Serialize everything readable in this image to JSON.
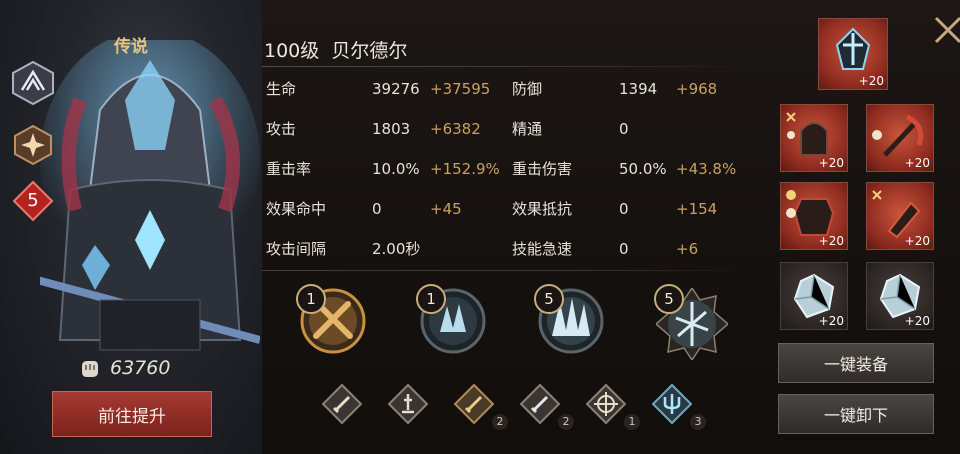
{
  "hero": {
    "rarity": "传说",
    "title": "100级  贝尔德尔",
    "level_badge": "5",
    "power": "63760",
    "goto_button": "前往提升"
  },
  "stats": [
    {
      "name": "生命",
      "base": "39276",
      "bonus": "+37595",
      "name2": "防御",
      "base2": "1394",
      "bonus2": "+968"
    },
    {
      "name": "攻击",
      "base": "1803",
      "bonus": "+6382",
      "name2": "精通",
      "base2": "0",
      "bonus2": ""
    },
    {
      "name": "重击率",
      "base": "10.0%",
      "bonus": "+152.9%",
      "name2": "重击伤害",
      "base2": "50.0%",
      "bonus2": "+43.8%"
    },
    {
      "name": "效果命中",
      "base": "0",
      "bonus": "+45",
      "name2": "效果抵抗",
      "base2": "0",
      "bonus2": "+154"
    },
    {
      "name": "攻击间隔",
      "base": "2.00秒",
      "bonus": "",
      "name2": "技能急速",
      "base2": "0",
      "bonus2": "+6"
    }
  ],
  "skills": [
    {
      "level": "1",
      "icon": "crossed-swords-icon"
    },
    {
      "level": "1",
      "icon": "ice-shard-icon"
    },
    {
      "level": "5",
      "icon": "ice-spikes-icon"
    },
    {
      "level": "5",
      "icon": "shatter-icon"
    }
  ],
  "runes": [
    {
      "icon": "sword-rune-icon",
      "count": ""
    },
    {
      "icon": "altar-rune-icon",
      "count": ""
    },
    {
      "icon": "dagger-rune-icon",
      "count": "2"
    },
    {
      "icon": "blade-rune-icon",
      "count": "2"
    },
    {
      "icon": "crosshair-rune-icon",
      "count": "1"
    },
    {
      "icon": "trident-rune-icon",
      "count": "3"
    }
  ],
  "equipment": [
    {
      "slot": "crest",
      "level": "+20"
    },
    {
      "slot": "helmet",
      "level": "+20"
    },
    {
      "slot": "weapon",
      "level": "+20"
    },
    {
      "slot": "armor",
      "level": "+20"
    },
    {
      "slot": "gloves",
      "level": "+20"
    },
    {
      "slot": "crystal-1",
      "level": "+20"
    },
    {
      "slot": "crystal-2",
      "level": "+20"
    }
  ],
  "buttons": {
    "equip_all": "一键装备",
    "unequip_all": "一键卸下"
  },
  "colors": {
    "gold": "#caa15e",
    "rarity": "#e9c27c",
    "goto_button": "#8f2c24",
    "equip_red": "#a53a2a"
  }
}
